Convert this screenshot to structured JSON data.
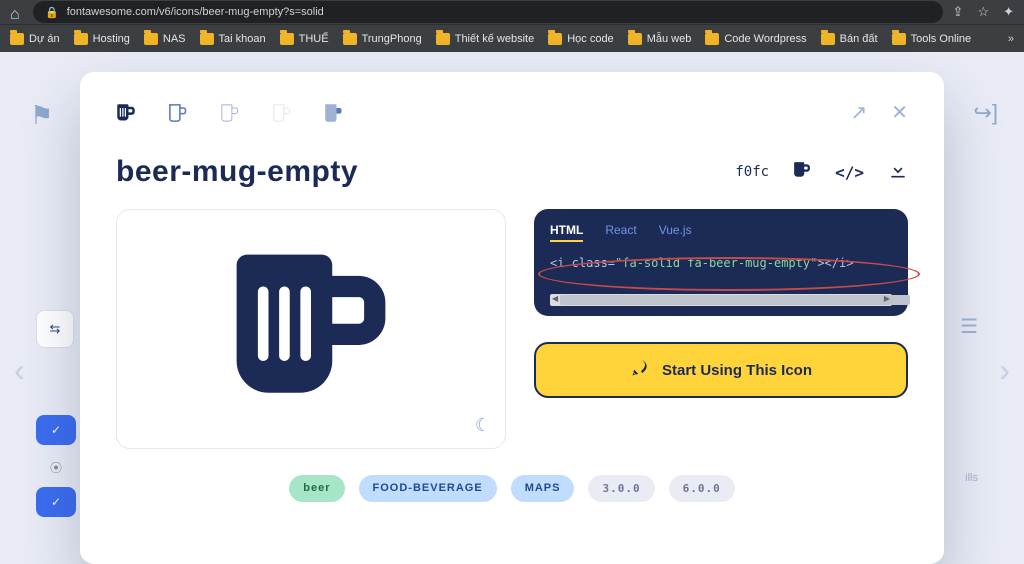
{
  "browser": {
    "url": "fontawesome.com/v6/icons/beer-mug-empty?s=solid",
    "bookmarks": [
      "Dự án",
      "Hosting",
      "NAS",
      "Tai khoan",
      "THUẾ",
      "TrungPhong",
      "Thiết kế website",
      "Học code",
      "Mẫu web",
      "Code Wordpress",
      "Bán đất",
      "Tools Online"
    ]
  },
  "header": {
    "icon_name": "beer-mug-empty",
    "unicode": "f0fc"
  },
  "code": {
    "tabs": [
      "HTML",
      "React",
      "Vue.js"
    ],
    "active_tab": "HTML",
    "snippet_prefix": "<i class=",
    "snippet_class": "\"fa-solid fa-beer-mug-empty\"",
    "snippet_suffix": "></i>"
  },
  "cta": {
    "label": "Start Using This Icon"
  },
  "tags": {
    "primary": "beer",
    "cat1": "FOOD-BEVERAGE",
    "cat2": "MAPS",
    "ver1": "3.0.0",
    "ver2": "6.0.0"
  },
  "behind": {
    "ills": "ills"
  }
}
